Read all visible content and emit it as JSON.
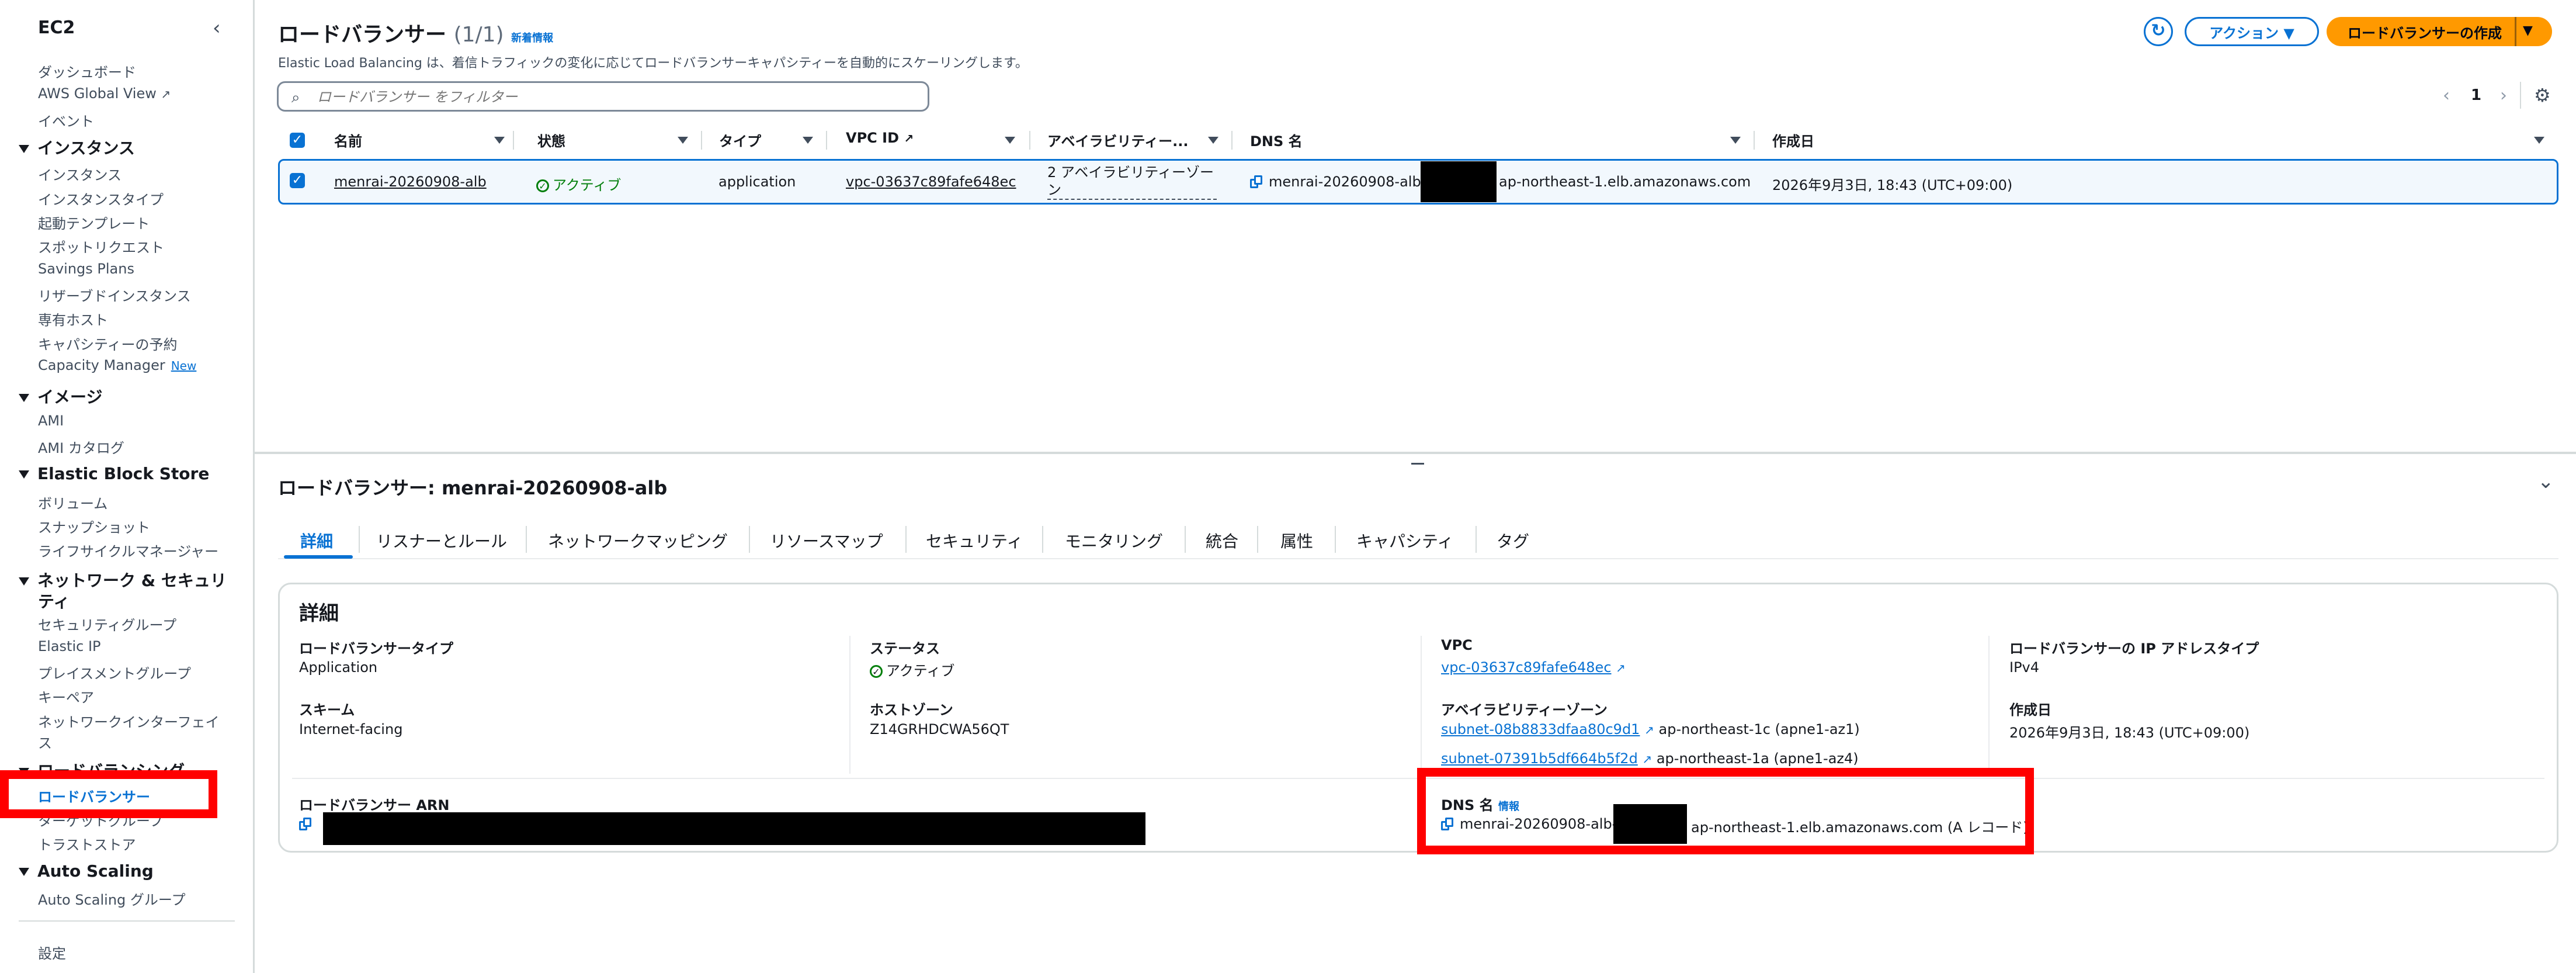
{
  "sidebar": {
    "title": "EC2",
    "items": {
      "dashboard": "ダッシュボード",
      "global_view": "AWS Global View",
      "events": "イベント",
      "instances_section": "インスタンス",
      "instances": "インスタンス",
      "instance_types": "インスタンスタイプ",
      "launch_templates": "起動テンプレート",
      "spot_requests": "スポットリクエスト",
      "savings_plans": "Savings Plans",
      "reserved_instances": "リザーブドインスタンス",
      "dedicated_hosts": "専有ホスト",
      "capacity_reservations": "キャパシティーの予約",
      "capacity_manager": "Capacity Manager",
      "new_badge": "New",
      "images_section": "イメージ",
      "ami": "AMI",
      "ami_catalog": "AMI カタログ",
      "ebs_section": "Elastic Block Store",
      "volumes": "ボリューム",
      "snapshots": "スナップショット",
      "lifecycle_manager": "ライフサイクルマネージャー",
      "netsec_section_line1": "ネットワーク & セキュリ",
      "netsec_section_line2": "ティ",
      "security_groups": "セキュリティグループ",
      "elastic_ip": "Elastic IP",
      "placement_groups": "プレイスメントグループ",
      "key_pairs": "キーペア",
      "network_interfaces_line1": "ネットワークインターフェイ",
      "network_interfaces_line2": "ス",
      "lb_section": "ロードバランシング",
      "load_balancers": "ロードバランサー",
      "target_groups": "ターゲットグループ",
      "trust_stores": "トラストストア",
      "autoscaling_section": "Auto Scaling",
      "autoscaling_groups": "Auto Scaling グループ",
      "settings": "設定"
    }
  },
  "list": {
    "title": "ロードバランサー",
    "count": "(1/1)",
    "info_link": "新着情報",
    "description": "Elastic Load Balancing は、着信トラフィックの変化に応じてロードバランサーキャパシティーを自動的にスケーリングします。",
    "search_placeholder": "ロードバランサー をフィルター",
    "actions_button": "アクション ▼",
    "create_button": "ロードバランサーの作成",
    "page_number": "1",
    "columns": [
      "名前",
      "状態",
      "タイプ",
      "VPC ID",
      "アベイラビリティー...",
      "DNS 名",
      "作成日"
    ],
    "rows": [
      {
        "name": "menrai-20260908-alb",
        "state": "アクティブ",
        "type": "application",
        "vpc_id": "vpc-03637c89fafe648ec",
        "az_line1": "2 アベイラビリティーゾー",
        "az_line2": "ン",
        "dns_prefix": "menrai-20260908-alb-",
        "dns_suffix": "ap-northeast-1.elb.amazonaws.com",
        "created": "2026年9月3日, 18:43 (UTC+09:00)"
      }
    ]
  },
  "detail": {
    "title": "ロードバランサー: menrai-20260908-alb",
    "tabs": [
      "詳細",
      "リスナーとルール",
      "ネットワークマッピング",
      "リソースマップ",
      "セキュリティ",
      "モニタリング",
      "統合",
      "属性",
      "キャパシティ",
      "タグ"
    ],
    "section_title": "詳細",
    "fields": {
      "lb_type_label": "ロードバランサータイプ",
      "lb_type_value": "Application",
      "status_label": "ステータス",
      "status_value": "アクティブ",
      "vpc_label": "VPC",
      "vpc_value": "vpc-03637c89fafe648ec",
      "ip_type_label": "ロードバランサーの IP アドレスタイプ",
      "ip_type_value": "IPv4",
      "scheme_label": "スキーム",
      "scheme_value": "Internet-facing",
      "hosted_zone_label": "ホストゾーン",
      "hosted_zone_value": "Z14GRHDCWA56QT",
      "az_label": "アベイラビリティーゾーン",
      "subnet1": "subnet-08b8833dfaa80c9d1",
      "subnet1_zone": "ap-northeast-1c (apne1-az1)",
      "subnet2": "subnet-07391b5df664b5f2d",
      "subnet2_zone": "ap-northeast-1a (apne1-az4)",
      "created_label": "作成日",
      "created_value": "2026年9月3日, 18:43 (UTC+09:00)",
      "arn_label": "ロードバランサー ARN",
      "dns_label": "DNS 名",
      "dns_info": "情報",
      "dns_prefix": "menrai-20260908-alb-",
      "dns_suffix": "ap-northeast-1.elb.amazonaws.com (A レコード)"
    }
  },
  "colors": {
    "link": "#0972d3",
    "primary": "#ff9900",
    "success": "#037f0c",
    "highlight": "#ff0000"
  }
}
